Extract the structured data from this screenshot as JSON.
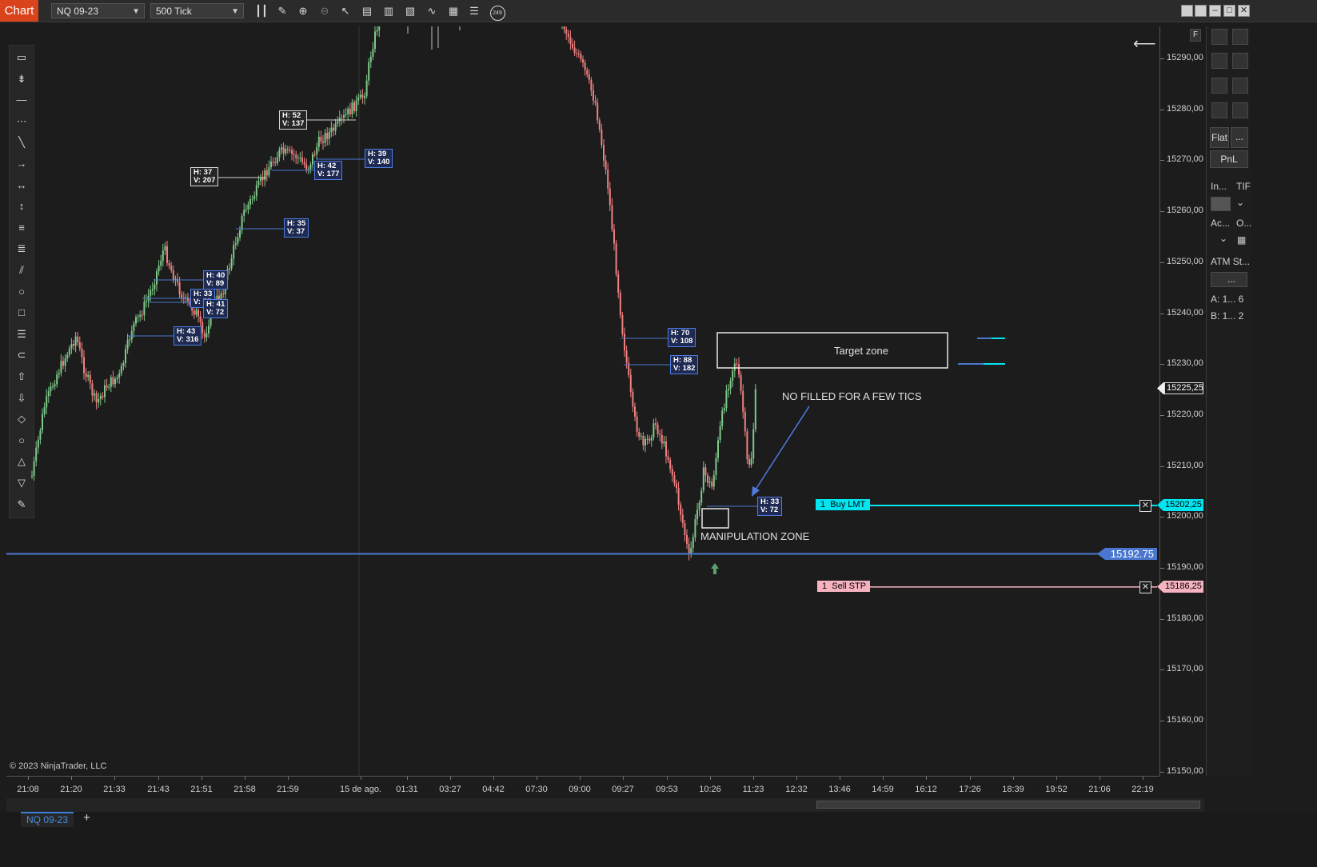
{
  "toolbar": {
    "chart_label": "Chart",
    "instrument": "NQ 09-23",
    "interval": "500 Tick",
    "badge": "249",
    "icons": [
      "bars-icon",
      "pencil-icon",
      "zoom-in-icon",
      "zoom-out-icon",
      "pointer-icon",
      "data-box-icon",
      "properties-icon",
      "strategies-icon",
      "indicators-icon",
      "templates-icon",
      "list-icon"
    ]
  },
  "left_tools": [
    "ruler-icon",
    "arrow-tool-icon",
    "line-icon",
    "ray-icon",
    "extended-line-icon",
    "arrow-line-icon",
    "horizontal-line-icon",
    "vertical-line-icon",
    "fib-retracement-icon",
    "fib-extension-icon",
    "channel-icon",
    "ellipse-icon",
    "rectangle-icon",
    "text-icon",
    "marker-icon",
    "arrow-up-icon",
    "arrow-down-icon",
    "diamond-icon",
    "dot-icon",
    "triangle-up-icon",
    "triangle-down-icon",
    "pen-icon"
  ],
  "price_axis": {
    "labels": [
      "15290,00",
      "15280,00",
      "15270,00",
      "15260,00",
      "15250,00",
      "15240,00",
      "15230,00",
      "15220,00",
      "15210,00",
      "15200,00",
      "15190,00",
      "15180,00",
      "15170,00",
      "15160,00",
      "15150,00"
    ],
    "last_price": "15225,25",
    "buy_price": "15202,25",
    "sell_price": "15186,25",
    "line_price": "15192.75"
  },
  "time_axis": [
    "21:08",
    "21:20",
    "21:33",
    "21:43",
    "21:51",
    "21:58",
    "21:59",
    "15 de ago.",
    "01:31",
    "03:27",
    "04:42",
    "07:30",
    "09:00",
    "09:27",
    "09:53",
    "10:26",
    "11:23",
    "12:32",
    "13:46",
    "14:59",
    "16:12",
    "17:26",
    "18:39",
    "19:52",
    "21:06",
    "22:19"
  ],
  "copyright": "© 2023 NinjaTrader, LLC",
  "hv_labels": [
    {
      "h": "H: 52",
      "v": "V: 137",
      "style": "white"
    },
    {
      "h": "H: 37",
      "v": "V: 207",
      "style": "white"
    },
    {
      "h": "H: 39",
      "v": "V: 140",
      "style": "blue"
    },
    {
      "h": "H: 42",
      "v": "V: 177",
      "style": "blue"
    },
    {
      "h": "H: 35",
      "v": "V: 37",
      "style": "blue"
    },
    {
      "h": "H: 40",
      "v": "V: 89",
      "style": "blue"
    },
    {
      "h": "H: 33",
      "v": "V: 55",
      "style": "blue"
    },
    {
      "h": "H: 41",
      "v": "V: 72",
      "style": "blue"
    },
    {
      "h": "H: 43",
      "v": "V: 316",
      "style": "blue"
    },
    {
      "h": "H: 70",
      "v": "V: 108",
      "style": "blue"
    },
    {
      "h": "H: 88",
      "v": "V: 182",
      "style": "blue"
    },
    {
      "h": "H: 33",
      "v": "V: 72",
      "style": "blue"
    }
  ],
  "annotations": {
    "target_zone": "Target zone",
    "no_filled": "NO FILLED FOR A FEW TICS",
    "manipulation": "MANIPULATION ZONE"
  },
  "orders": {
    "buy": {
      "qty": "1",
      "label": "Buy LMT",
      "color": "#00e5f0"
    },
    "sell": {
      "qty": "1",
      "label": "Sell STP",
      "color": "#f6b3bf"
    }
  },
  "right_panel": {
    "flat": "Flat",
    "flat_more": "...",
    "pnl": "PnL",
    "instrument_lbl": "In...",
    "tif_lbl": "TIF",
    "account_lbl": "Ac...",
    "o_lbl": "O...",
    "atm_lbl": "ATM St...",
    "atm_value": "...",
    "a_row": "A:  1...   6",
    "b_row": "B:  1...   2",
    "f_label": "F"
  },
  "bottom": {
    "tab": "NQ 09-23",
    "add": "+"
  },
  "colors": {
    "up": "#7fc98a",
    "down": "#f08080",
    "line": "#4a78d0",
    "buy": "#00e5f0",
    "sell": "#f6b3bf",
    "accent": "#d9441c"
  }
}
